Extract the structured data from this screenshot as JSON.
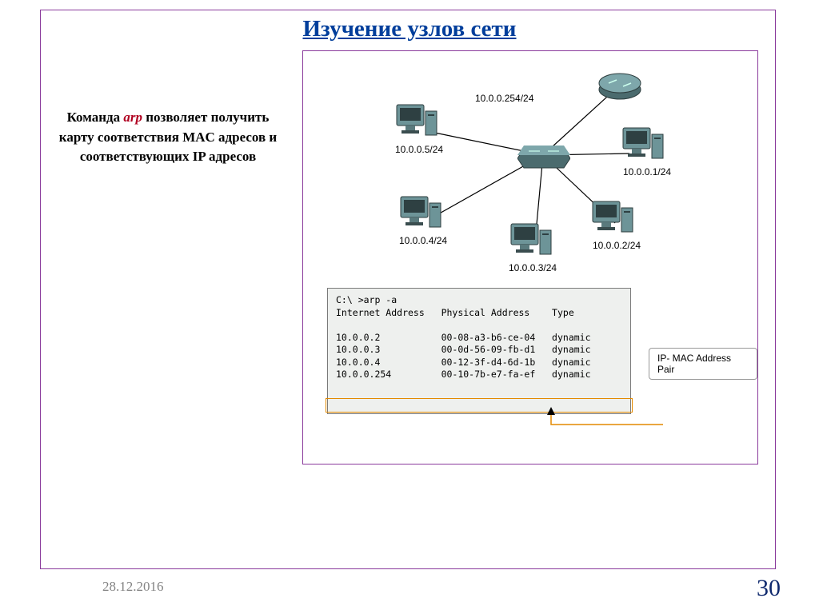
{
  "title": "Изучение узлов сети",
  "left_text": {
    "pre": "Команда ",
    "cmd": "arp",
    "post": " позволяет получить карту соответствия MAC адресов и соответствующих IP адресов"
  },
  "nodes": {
    "router": "10.0.0.254/24",
    "pc1": "10.0.0.1/24",
    "pc2": "10.0.0.2/24",
    "pc3": "10.0.0.3/24",
    "pc4": "10.0.0.4/24",
    "pc5": "10.0.0.5/24"
  },
  "terminal": {
    "cmd": "C:\\ >arp -a",
    "hdr_ip": "Internet Address",
    "hdr_mac": "Physical Address",
    "hdr_type": "Type",
    "rows": [
      {
        "ip": "10.0.0.2",
        "mac": "00-08-a3-b6-ce-04",
        "type": "dynamic"
      },
      {
        "ip": "10.0.0.3",
        "mac": "00-0d-56-09-fb-d1",
        "type": "dynamic"
      },
      {
        "ip": "10.0.0.4",
        "mac": "00-12-3f-d4-6d-1b",
        "type": "dynamic"
      },
      {
        "ip": "10.0.0.254",
        "mac": "00-10-7b-e7-fa-ef",
        "type": "dynamic"
      }
    ]
  },
  "callout": "IP- MAC Address Pair",
  "footer": {
    "date": "28.12.2016",
    "num": "30"
  }
}
